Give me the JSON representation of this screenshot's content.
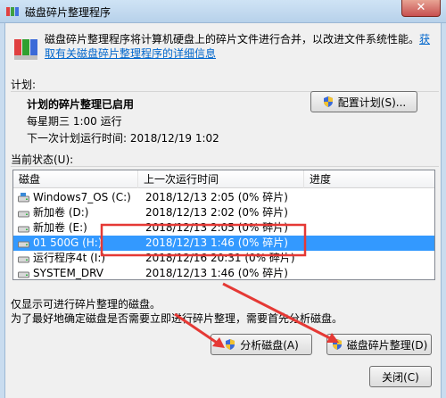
{
  "window": {
    "title": "磁盘碎片整理程序",
    "close_glyph": "✕"
  },
  "intro": {
    "text": "磁盘碎片整理程序将计算机硬盘上的碎片文件进行合并，以改进文件系统性能。",
    "link": "获取有关磁盘碎片整理程序的详细信息"
  },
  "schedule": {
    "section_label": "计划:",
    "status": "计划的碎片整理已启用",
    "frequency": "每星期三 1:00 运行",
    "next_run": "下一次计划运行时间: 2018/12/19 1:02",
    "configure_button": "配置计划(S)..."
  },
  "current_status": {
    "section_label": "当前状态(U):",
    "columns": [
      "磁盘",
      "上一次运行时间",
      "进度"
    ],
    "rows": [
      {
        "disk": "Windows7_OS (C:)",
        "last_run": "2018/12/13 2:05 (0% 碎片)",
        "progress": "",
        "icon": "os-drive-icon"
      },
      {
        "disk": "新加卷 (D:)",
        "last_run": "2018/12/13 2:02 (0% 碎片)",
        "progress": "",
        "icon": "drive-icon"
      },
      {
        "disk": "新加卷 (E:)",
        "last_run": "2018/12/13 2:05 (0% 碎片)",
        "progress": "",
        "icon": "drive-icon"
      },
      {
        "disk": "01 500G (H:)",
        "last_run": "2018/12/13 1:46 (0% 碎片)",
        "progress": "",
        "icon": "drive-icon"
      },
      {
        "disk": "运行程序4t (I:)",
        "last_run": "2018/12/16 20:31 (0% 碎片)",
        "progress": "",
        "icon": "drive-icon"
      },
      {
        "disk": "SYSTEM_DRV",
        "last_run": "2018/12/13 1:46 (0% 碎片)",
        "progress": "",
        "icon": "drive-icon"
      }
    ],
    "selected_index": 3
  },
  "notes": {
    "line1": "仅显示可进行碎片整理的磁盘。",
    "line2": "为了最好地确定磁盘是否需要立即进行碎片整理，需要首先分析磁盘。"
  },
  "buttons": {
    "analyze": "分析磁盘(A)",
    "defrag": "磁盘碎片整理(D)",
    "close": "关闭(C)"
  },
  "colors": {
    "selection": "#3399ff",
    "link": "#0066cc",
    "annotation": "#e53935"
  }
}
